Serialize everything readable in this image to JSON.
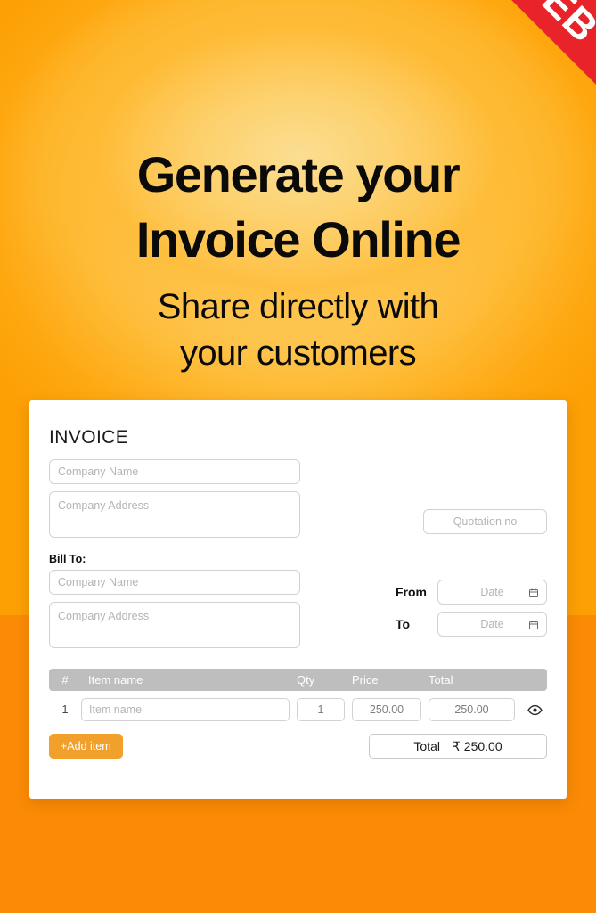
{
  "ribbon": {
    "label": "WEB"
  },
  "hero": {
    "headline_line1": "Generate your",
    "headline_line2": "Invoice Online",
    "subhead_line1": "Share directly with",
    "subhead_line2": "your customers"
  },
  "card": {
    "title": "INVOICE",
    "seller": {
      "company_name_placeholder": "Company Name",
      "company_name_value": "",
      "company_address_placeholder": "Company Address",
      "company_address_value": ""
    },
    "quotation": {
      "placeholder": "Quotation no",
      "value": ""
    },
    "bill_to": {
      "label": "Bill To:",
      "company_name_placeholder": "Company Name",
      "company_name_value": "",
      "company_address_placeholder": "Company Address",
      "company_address_value": ""
    },
    "dates": {
      "from_label": "From",
      "to_label": "To",
      "from_placeholder": "Date",
      "to_placeholder": "Date",
      "from_value": "",
      "to_value": "",
      "calendar_icon": "calendar-icon"
    },
    "items_table": {
      "columns": [
        "#",
        "Item name",
        "Qty",
        "Price",
        "Total"
      ],
      "rows": [
        {
          "index": "1",
          "item_name_placeholder": "Item name",
          "item_name_value": "",
          "qty": "1",
          "price": "250.00",
          "total": "250.00",
          "preview_icon": "eye-icon"
        }
      ]
    },
    "add_item_label": "+Add item",
    "total": {
      "label": "Total",
      "currency": "₹",
      "amount": "250.00"
    }
  },
  "colors": {
    "background_top": "#FFA800",
    "background_bottom": "#FB8B05",
    "glow": "#FBDE92",
    "ribbon_red": "#E8242A",
    "accent_orange": "#F2A02C",
    "table_header_gray": "#BEBEBE",
    "card_white": "#FFFFFF",
    "text_dark": "#0A0A0A",
    "placeholder_gray": "#B4B4B4"
  }
}
